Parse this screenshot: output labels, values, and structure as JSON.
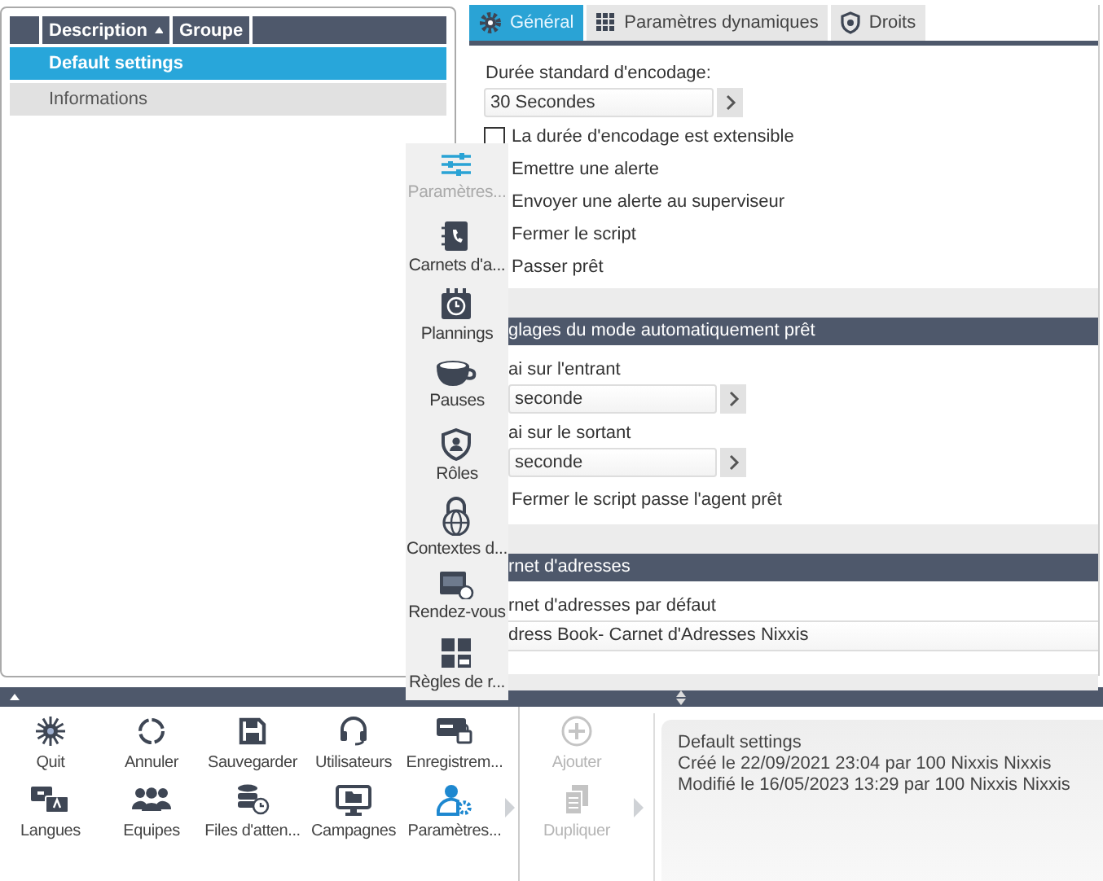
{
  "list": {
    "columns": [
      {
        "label": "Description",
        "sorted": true
      },
      {
        "label": "Groupe",
        "sorted": false
      }
    ],
    "rows": [
      {
        "description": "Default settings",
        "selected": true
      },
      {
        "description": "Informations",
        "selected": false
      }
    ]
  },
  "tabs": [
    {
      "label": "Général",
      "selected": true
    },
    {
      "label": "Paramètres dynamiques",
      "selected": false
    },
    {
      "label": "Droits",
      "selected": false
    }
  ],
  "general": {
    "encoding_label": "Durée standard d'encodage:",
    "encoding_value": "30 Secondes",
    "extensible": {
      "label": "La durée d'encodage est extensible",
      "checked": false
    },
    "options": [
      "Emettre une alerte",
      "Envoyer une alerte au superviseur",
      "Fermer le script",
      "Passer prêt"
    ]
  },
  "auto_ready": {
    "header": "glages du mode automatiquement prêt",
    "incoming_label": "ai sur l'entrant",
    "incoming_value": "seconde",
    "outgoing_label": "ai sur le sortant",
    "outgoing_value": "seconde",
    "close_option": "Fermer le script passe l'agent prêt"
  },
  "address_book": {
    "header": "rnet d'adresses",
    "default_label": "rnet d'adresses par défaut",
    "default_value": "dress Book- Carnet d'Adresses Nixxis"
  },
  "side_menu": [
    {
      "label": "Paramètres...",
      "selected": true
    },
    {
      "label": "Carnets d'a...",
      "selected": false
    },
    {
      "label": "Plannings",
      "selected": false
    },
    {
      "label": "Pauses",
      "selected": false
    },
    {
      "label": "Rôles",
      "selected": false
    },
    {
      "label": "Contextes d...",
      "selected": false
    },
    {
      "label": "Rendez-vous",
      "selected": false
    },
    {
      "label": "Règles de r...",
      "selected": false
    }
  ],
  "toolbar": [
    {
      "label": "Quit",
      "selected": false
    },
    {
      "label": "Annuler",
      "selected": false
    },
    {
      "label": "Sauvegarder",
      "selected": false
    },
    {
      "label": "Utilisateurs",
      "selected": false
    },
    {
      "label": "Enregistrem...",
      "selected": false
    },
    {
      "label": "Langues",
      "selected": false
    },
    {
      "label": "Equipes",
      "selected": false
    },
    {
      "label": "Files d'atten...",
      "selected": false
    },
    {
      "label": "Campagnes",
      "selected": false
    },
    {
      "label": "Paramètres...",
      "selected": true
    }
  ],
  "actions": [
    {
      "label": "Ajouter",
      "disabled": true
    },
    {
      "label": "Dupliquer",
      "disabled": true
    }
  ],
  "info": [
    "Default settings",
    "Créé le 22/09/2021 23:04 par 100 Nixxis Nixxis",
    "Modifié le 16/05/2023 13:29 par 100 Nixxis Nixxis"
  ]
}
